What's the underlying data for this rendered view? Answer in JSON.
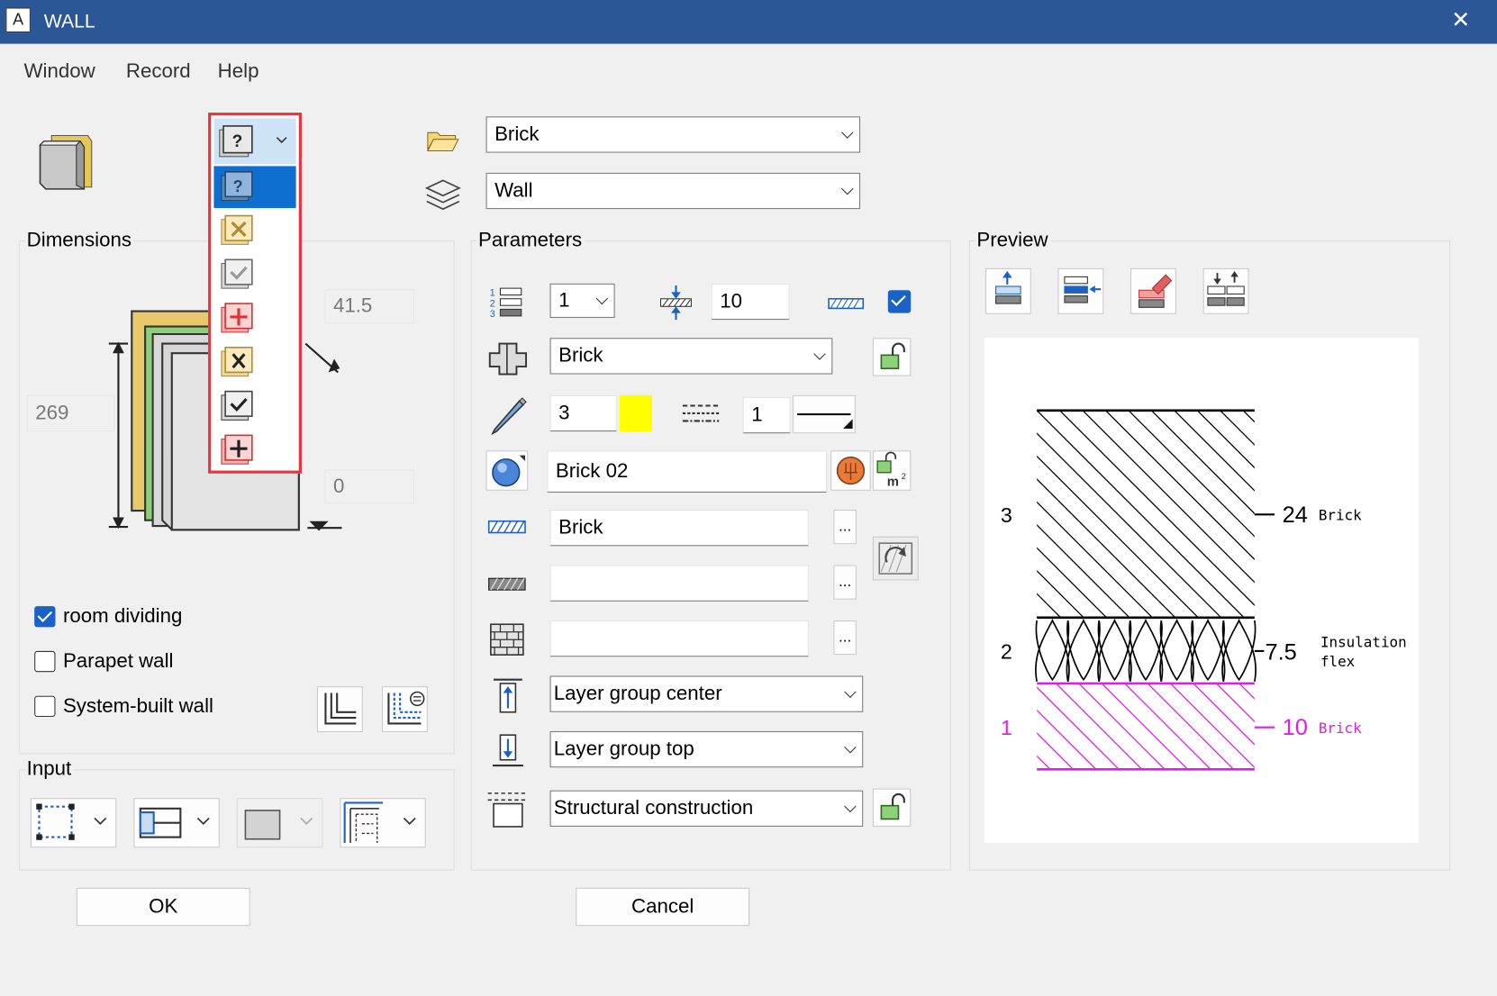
{
  "window": {
    "title": "WALL",
    "app_icon_letter": "A",
    "close_glyph": "✕"
  },
  "menu": [
    "Window",
    "Record",
    "Help"
  ],
  "top": {
    "material_combo": "Brick",
    "layer_combo": "Wall"
  },
  "dimensions": {
    "legend": "Dimensions",
    "height_value": "269",
    "thickness_value": "41.5",
    "offset_value": "0",
    "room_dividing_label": "room dividing",
    "room_dividing_checked": true,
    "parapet_label": "Parapet wall",
    "parapet_checked": false,
    "system_built_label": "System-built wall",
    "system_built_checked": false
  },
  "input": {
    "legend": "Input"
  },
  "status_dropdown": {
    "selected_index": 0,
    "items": [
      "question-layer-icon",
      "cross-yellow-icon",
      "check-grey-icon",
      "plus-red-icon",
      "cross-bold-icon",
      "check-bold-icon",
      "plus-bold-icon"
    ]
  },
  "parameters": {
    "legend": "Parameters",
    "layer_number": "1",
    "thickness": "10",
    "thickness_checkbox": true,
    "material": "Brick",
    "pen_value": "3",
    "pen_color": "#ffff00",
    "line_value": "1",
    "surface": "Brick 02",
    "hatch_1": "Brick",
    "hatch_2": "",
    "hatch_3": "",
    "anchor_center": "Layer group center",
    "anchor_top": "Layer group top",
    "construction": "Structural construction",
    "dots_label": "..."
  },
  "preview": {
    "legend": "Preview",
    "layers": [
      {
        "index": "3",
        "thickness": "24",
        "name": "Brick",
        "color": "#000000"
      },
      {
        "index": "2",
        "thickness": "7.5",
        "name": "Insulation",
        "name2": "flex",
        "color": "#000000"
      },
      {
        "index": "1",
        "thickness": "10",
        "name": "Brick",
        "color": "#e01ee0"
      }
    ]
  },
  "buttons": {
    "ok": "OK",
    "cancel": "Cancel"
  },
  "colors": {
    "titlebar": "#2b5797",
    "accent": "#1a62c4",
    "highlight": "#e8343a",
    "selection": "#0f6fd1"
  }
}
